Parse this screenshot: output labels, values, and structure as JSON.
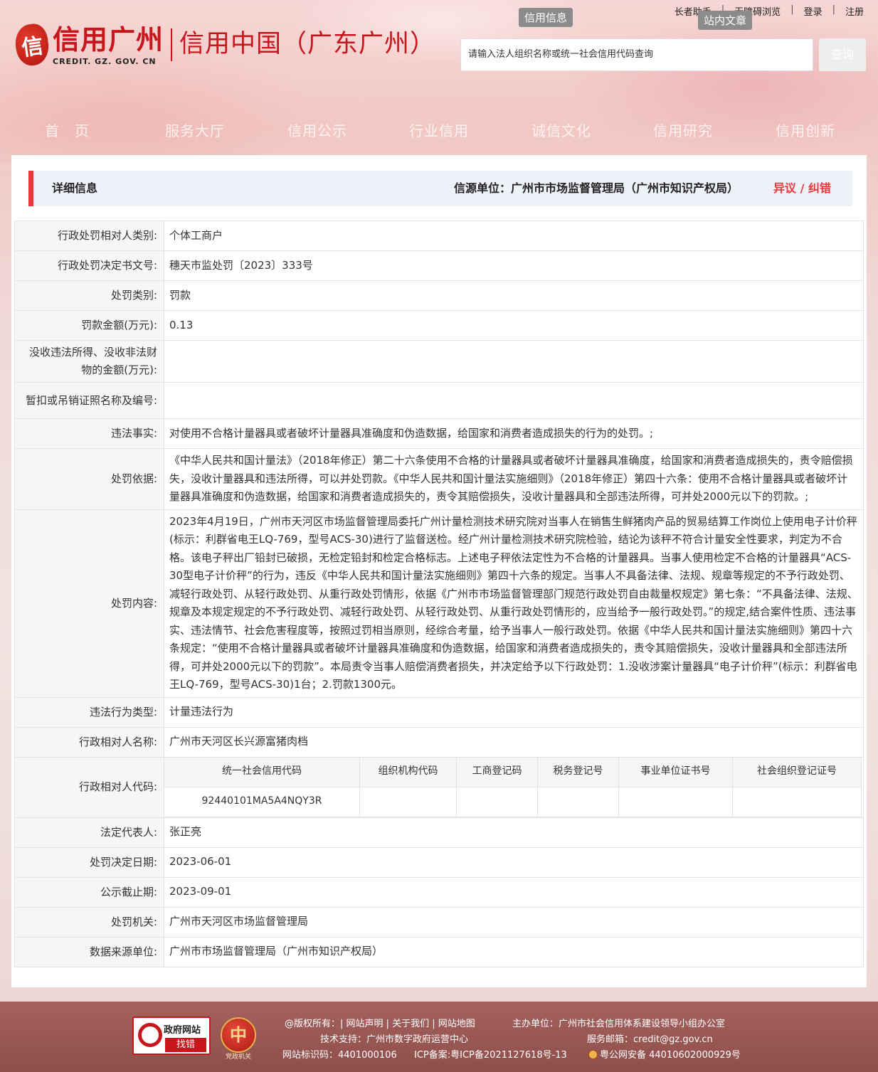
{
  "header": {
    "logo_mark": "信",
    "logo_cn": "信用广州",
    "logo_en": "CREDIT. GZ. GOV. CN",
    "logo_sub": "信用中国（广东广州）",
    "top_links": [
      "长者助手",
      "无障碍浏览",
      "登录",
      "注册"
    ],
    "search_tabs": [
      "信用信息",
      "站内文章"
    ],
    "search_placeholder": "请输入法人组织名称或统一社会信用代码查询",
    "search_button": "查询"
  },
  "nav": [
    "首　页",
    "服务大厅",
    "信用公示",
    "行业信用",
    "诚信文化",
    "信用研究",
    "信用创新"
  ],
  "panel": {
    "title": "详细信息",
    "source_label": "信源单位：广州市市场监督管理局（广州市知识产权局）",
    "objection_label": "异议 / 纠错"
  },
  "details": [
    {
      "key": "行政处罚相对人类别:",
      "value": "个体工商户"
    },
    {
      "key": "行政处罚决定书文号:",
      "value": "穗天市监处罚〔2023〕333号"
    },
    {
      "key": "处罚类别:",
      "value": "罚款"
    },
    {
      "key": "罚款金额(万元):",
      "value": "0.13"
    },
    {
      "key": "没收违法所得、没收非法财物的金额(万元):",
      "value": ""
    },
    {
      "key": "暂扣或吊销证照名称及编号:",
      "value": ""
    },
    {
      "key": "违法事实:",
      "value": "对使用不合格计量器具或者破坏计量器具准确度和伪造数据，给国家和消费者造成损失的行为的处罚。;"
    },
    {
      "key": "处罚依据:",
      "value": "《中华人民共和国计量法》（2018年修正）第二十六条使用不合格的计量器具或者破坏计量器具准确度，给国家和消费者造成损失的，责令赔偿损失，没收计量器具和违法所得，可以并处罚款。《中华人民共和国计量法实施细则》（2018年修正）第四十六条：使用不合格计量器具或者破坏计量器具准确度和伪造数据，给国家和消费者造成损失的，责令其赔偿损失，没收计量器具和全部违法所得，可并处2000元以下的罚款。;"
    },
    {
      "key": "处罚内容:",
      "value": "2023年4月19日，广州市天河区市场监督管理局委托广州计量检测技术研究院对当事人在销售生鲜猪肉产品的贸易结算工作岗位上使用电子计价秤(标示：利群省电王LQ-769，型号ACS-30)进行了监督送检。经广州计量检测技术研究院检验，结论为该秤不符合计量安全性要求，判定为不合格。该电子秤出厂铅封已破损，无检定铅封和检定合格标志。上述电子秤依法定性为不合格的计量器具。当事人使用检定不合格的计量器具“ACS-30型电子计价秤”的行为，违反《中华人民共和国计量法实施细则》第四十六条的规定。当事人不具备法律、法规、规章等规定的不予行政处罚、减轻行政处罚、从轻行政处罚、从重行政处罚情形，依据《广州市市场监督管理部门规范行政处罚自由裁量权规定》第七条：“不具备法律、法规、规章及本规定规定的不予行政处罚、减轻行政处罚、从轻行政处罚、从重行政处罚情形的，应当给予一般行政处罚。”的规定,结合案件性质、违法事实、违法情节、社会危害程度等，按照过罚相当原则，经综合考量，给予当事人一般行政处罚。依据《中华人民共和国计量法实施细则》第四十六条规定：“使用不合格计量器具或者破坏计量器具准确度和伪造数据，给国家和消费者造成损失的，责令其赔偿损失，没收计量器具和全部违法所得，可并处2000元以下的罚款”。本局责令当事人赔偿消费者损失，并决定给予以下行政处罚：1.没收涉案计量器具“电子计价秤”(标示：利群省电王LQ-769，型号ACS-30)1台；2.罚款1300元。"
    },
    {
      "key": "违法行为类型:",
      "value": "计量违法行为"
    },
    {
      "key": "行政相对人名称:",
      "value": "广州市天河区长兴源富猪肉档"
    }
  ],
  "codes": {
    "key": "行政相对人代码:",
    "headers": [
      "统一社会信用代码",
      "组织机构代码",
      "工商登记码",
      "税务登记号",
      "事业单位证书号",
      "社会组织登记证号"
    ],
    "values": [
      "92440101MA5A4NQY3R",
      "",
      "",
      "",
      "",
      ""
    ]
  },
  "details_after": [
    {
      "key": "法定代表人:",
      "value": "张正亮"
    },
    {
      "key": "处罚决定日期:",
      "value": "2023-06-01"
    },
    {
      "key": "公示截止期:",
      "value": "2023-09-01"
    },
    {
      "key": "处罚机关:",
      "value": "广州市天河区市场监督管理局"
    },
    {
      "key": "数据来源单位:",
      "value": "广州市市场监督管理局（广州市知识产权局）"
    }
  ],
  "footer": {
    "gov_badge_title": "政府网站",
    "gov_badge_action": "找错",
    "party_mark": "中",
    "party_text": "党政机关",
    "line1": "@版权所有：| 网站声明 | 关于我们 | 网站地图",
    "host": "主办单位：广州市社会信用体系建设领导小组办公室",
    "tech": "技术支持：广州市数字政府运营中心",
    "email": "服务邮箱：credit@gz.gov.cn",
    "site_id": "网站标识码：4401000106",
    "icp": "ICP备案:粤ICP备2021127618号-13",
    "police": "粤公网安备 44010602000929号"
  }
}
